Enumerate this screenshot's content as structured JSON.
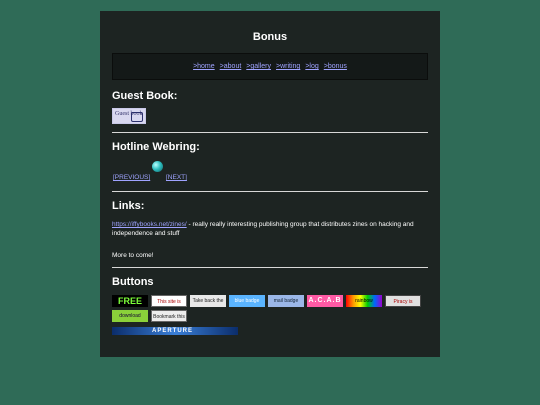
{
  "page": {
    "title": "Bonus"
  },
  "nav": {
    "links": [
      ">home",
      ">about",
      ">gallery",
      ">writing",
      ">log",
      ">bonus"
    ]
  },
  "sections": {
    "guestbook": {
      "heading": "Guest Book:",
      "button_text": "Guest book"
    },
    "hotline": {
      "heading": "Hotline Webring:",
      "previous": "[PREVIOUS]",
      "next": "[NEXT]"
    },
    "links": {
      "heading": "Links:",
      "link_text": "https://iffybooks.net/zines/",
      "description": " - really really interesting publishing group that distributes zines on hacking and independence and stuff",
      "more": "More to come!"
    },
    "buttons": {
      "heading": "Buttons",
      "badges": [
        "FREE",
        "This site is certified 100% AI-free",
        "Take back the web",
        "blue badge",
        "mail badge",
        "A.C.A.B",
        "rainbow",
        "Piracy is Liberation",
        "download",
        "Bookmark this Page!"
      ],
      "aperture": "APERTURE"
    }
  },
  "colors": {
    "background": "#2f6b57",
    "panel": "#1d2422",
    "link": "#9fa3ff"
  }
}
